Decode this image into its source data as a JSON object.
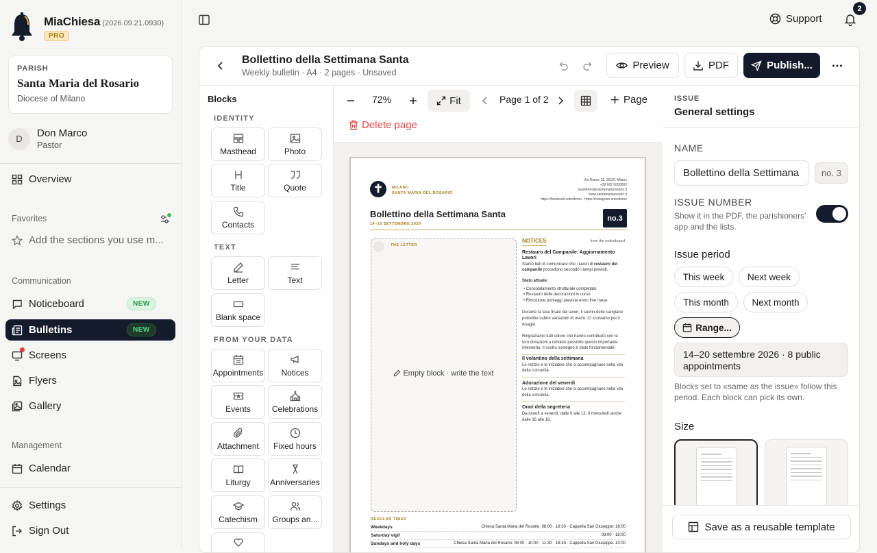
{
  "app": {
    "name": "MiaChiesa",
    "version": "(2026.09.21.0930)",
    "plan": "PRO"
  },
  "parish": {
    "caption": "PARISH",
    "name": "Santa Maria del Rosario",
    "diocese": "Diocese of Milano"
  },
  "user": {
    "initial": "D",
    "name": "Don Marco",
    "role": "Pastor"
  },
  "nav": {
    "overview": "Overview",
    "favorites_label": "Favorites",
    "favorites_hint": "Add the sections you use m...",
    "communication_label": "Communication",
    "noticeboard": "Noticeboard",
    "bulletins": "Bulletins",
    "new_badge": "NEW",
    "screens": "Screens",
    "flyers": "Flyers",
    "gallery": "Gallery",
    "management_label": "Management",
    "calendar": "Calendar",
    "settings": "Settings",
    "sign_out": "Sign Out"
  },
  "topbar": {
    "support": "Support",
    "notifications": "2"
  },
  "doc": {
    "title": "Bollettino della Settimana Santa",
    "meta": "Weekly bulletin · A4 · 2 pages · Unsaved",
    "preview": "Preview",
    "pdf": "PDF",
    "publish": "Publish..."
  },
  "blocks": {
    "title": "Blocks",
    "identity_label": "IDENTITY",
    "text_label": "TEXT",
    "data_label": "FROM YOUR DATA",
    "identity": [
      "Masthead",
      "Photo",
      "Title",
      "Quote",
      "Contacts"
    ],
    "text": [
      "Letter",
      "Text",
      "Blank space"
    ],
    "data": [
      "Appointments",
      "Notices",
      "Events",
      "Celebrations",
      "Attachment",
      "Fixed hours",
      "Liturgy",
      "Anniversaries",
      "Catechism",
      "Groups an..."
    ]
  },
  "canvas": {
    "zoom": "72%",
    "fit": "Fit",
    "page_indicator": "Page 1 of 2",
    "add_page": "Page",
    "delete_page": "Delete page"
  },
  "bulletin_page": {
    "logo": "✝",
    "city": "MILANO",
    "parish": "SANTA MARIA DEL ROSARIO",
    "contact": [
      "Via Roma, 15, 20121 Milano",
      "+39 002 0000002",
      "segreteria@santamariarosario.it",
      "www.santamariarosario.it",
      "https://facebook.com/demo · https://instagram.com/demo"
    ],
    "title": "Bollettino della Settimana Santa",
    "dates": "14–20 SETTEMBRE 2026",
    "number": "no.3",
    "letter_caption": "THE LETTER",
    "letter_empty": "Empty block · write the text",
    "notices_head": "NOTICES",
    "notices_from": "from the noticeboard",
    "n1_title": "Restauro del Campanile: Aggiornamento Lavori",
    "n1_p1a": "Siamo lieti di comunicare che i lavori di ",
    "n1_p1b": "restauro del campanile",
    "n1_p1c": " procedono secondo i tempi previsti.",
    "n1_status": "Stato attuale:",
    "n1_items": [
      "Consolidamento strutturale completato",
      "Restauro delle decorazioni in corso",
      "Rimozione ponteggi prevista entro fine mese"
    ],
    "n1_p2": "Durante la fase finale dei lavori, il suono delle campane potrebbe subire variazioni di orario. Ci scusiamo per il disagio.",
    "n1_p3": "Ringraziamo tutti coloro che hanno contribuito con le loro donazioni a rendere possibile questo importante intervento. Il vostro sostegno è stato fondamentale!",
    "n2_title": "Il volantino della settimana",
    "n2_p": "Le notizie e le iniziative che ci accompagnano nella vita della comunità.",
    "n3_title": "Adorazione del venerdì",
    "n3_p": "Le notizie e le iniziative che ci accompagnano nella vita della comunità.",
    "n4_title": "Orari della segreteria",
    "n4_p": "Da lunedì a venerdì, dalle 9 alle 12. Il mercoledì anche dalle 16 alle 18.",
    "regular_caption": "REGULAR TIMES",
    "regular": [
      {
        "day": "Weekdays",
        "times": "Chiesa Santa Maria del Rosario: 08:00 · 18:30 · Cappella San Giuseppe: 18:00"
      },
      {
        "day": "Saturday vigil",
        "times": "08:00 · 18:00"
      },
      {
        "day": "Sundays and holy days",
        "times": "Chiesa Santa Maria del Rosario: 08:30 · 10:00 · 11:30 · 18:30 · Cappella San Giuseppe: 10:00"
      }
    ]
  },
  "settings": {
    "caption": "ISSUE",
    "title": "General settings",
    "name_label": "NAME",
    "name_value": "Bollettino della Settimana Santa",
    "name_no": "no. 3",
    "issue_number_label": "ISSUE NUMBER",
    "issue_number_help": "Show it in the PDF, the parishioners' app and the lists.",
    "issue_number_on": true,
    "period_title": "Issue period",
    "this_week": "This week",
    "next_week": "Next week",
    "this_month": "This month",
    "next_month": "Next month",
    "range": "Range...",
    "period_summary": "14–20 settembre 2026 · 8 public appointments",
    "period_help": "Blocks set to «same as the issue» follow this period. Each block can pick its own.",
    "size_title": "Size",
    "save_template": "Save as a reusable template"
  },
  "colors": {
    "accent_dark": "#141b2b",
    "gold": "#a77c18",
    "danger": "#e04747",
    "new_green": "#2f9a4f"
  }
}
